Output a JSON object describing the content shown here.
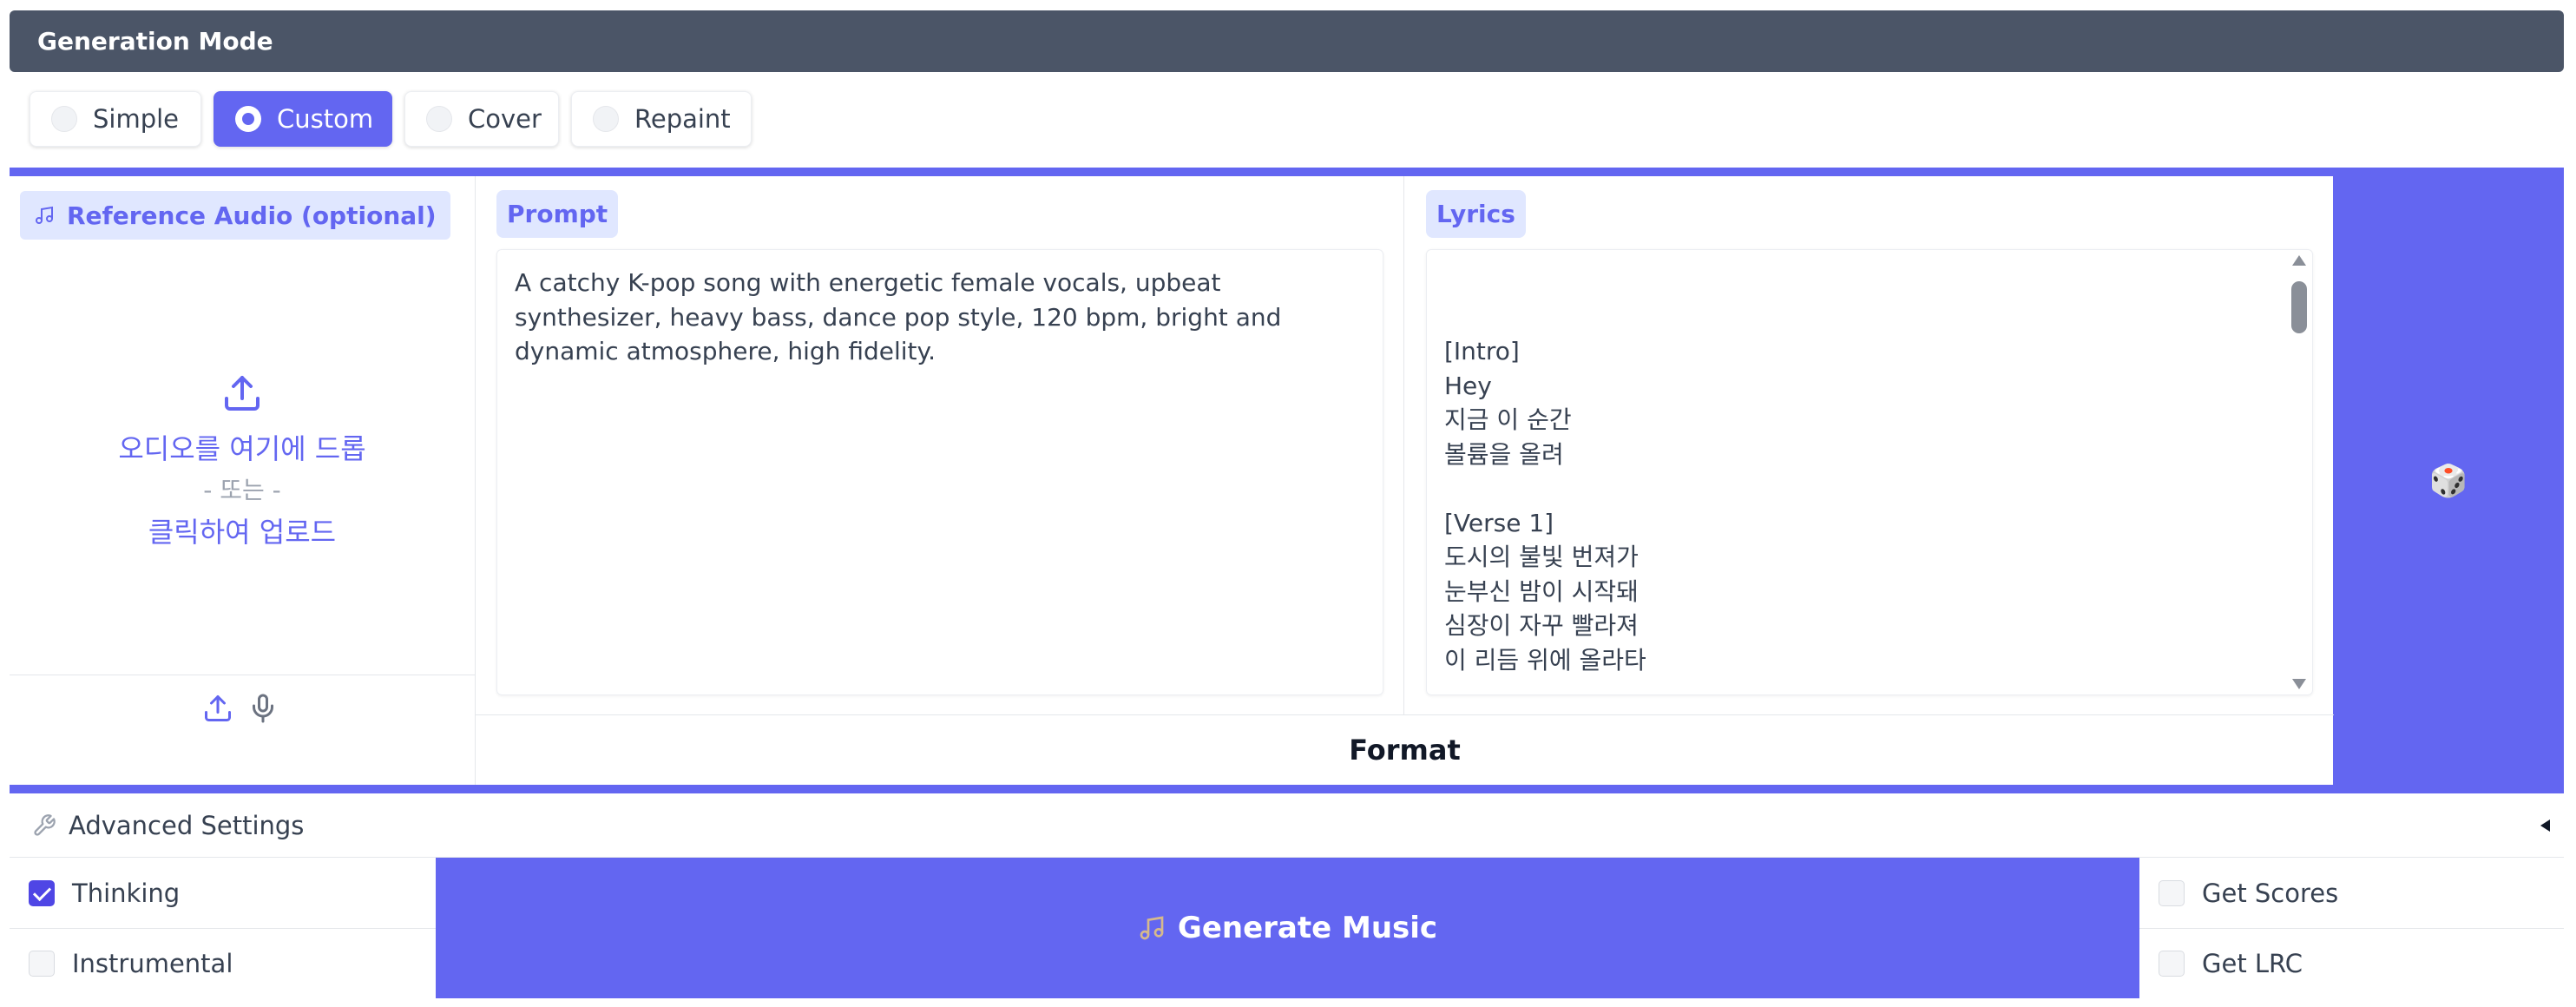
{
  "header": {
    "title": "Generation Mode"
  },
  "modes": [
    {
      "label": "Simple",
      "selected": false
    },
    {
      "label": "Custom",
      "selected": true
    },
    {
      "label": "Cover",
      "selected": false
    },
    {
      "label": "Repaint",
      "selected": false
    }
  ],
  "reference_audio": {
    "label": "Reference Audio (optional)",
    "drop_text": "오디오를 여기에 드롭",
    "or_text": "- 또는 -",
    "click_text": "클릭하여 업로드"
  },
  "prompt": {
    "label": "Prompt",
    "value": "A catchy K-pop song with energetic female vocals, upbeat synthesizer, heavy bass, dance pop style, 120 bpm, bright and dynamic atmosphere, high fidelity."
  },
  "lyrics": {
    "label": "Lyrics",
    "value": "[Intro]\nHey\n지금 이 순간\n볼륨을 올려\n\n[Verse 1]\n도시의 불빛 번져가\n눈부신 밤이 시작돼\n심장이 자꾸 빨라져\n이 리듬 위에 올라타\n\n멈출 수 없어 이 떨림\n전부 다 깨워 inside me"
  },
  "format_label": "Format",
  "dice_icon": "🎲",
  "advanced": {
    "label": "Advanced Settings"
  },
  "options": {
    "thinking": {
      "label": "Thinking",
      "checked": true
    },
    "instrumental": {
      "label": "Instrumental",
      "checked": false
    },
    "get_scores": {
      "label": "Get Scores",
      "checked": false
    },
    "get_lrc": {
      "label": "Get LRC",
      "checked": false
    }
  },
  "generate_label": "Generate Music",
  "colors": {
    "accent": "#6366f1",
    "header_bg": "#4b5567",
    "label_bg": "#e0e7ff"
  }
}
